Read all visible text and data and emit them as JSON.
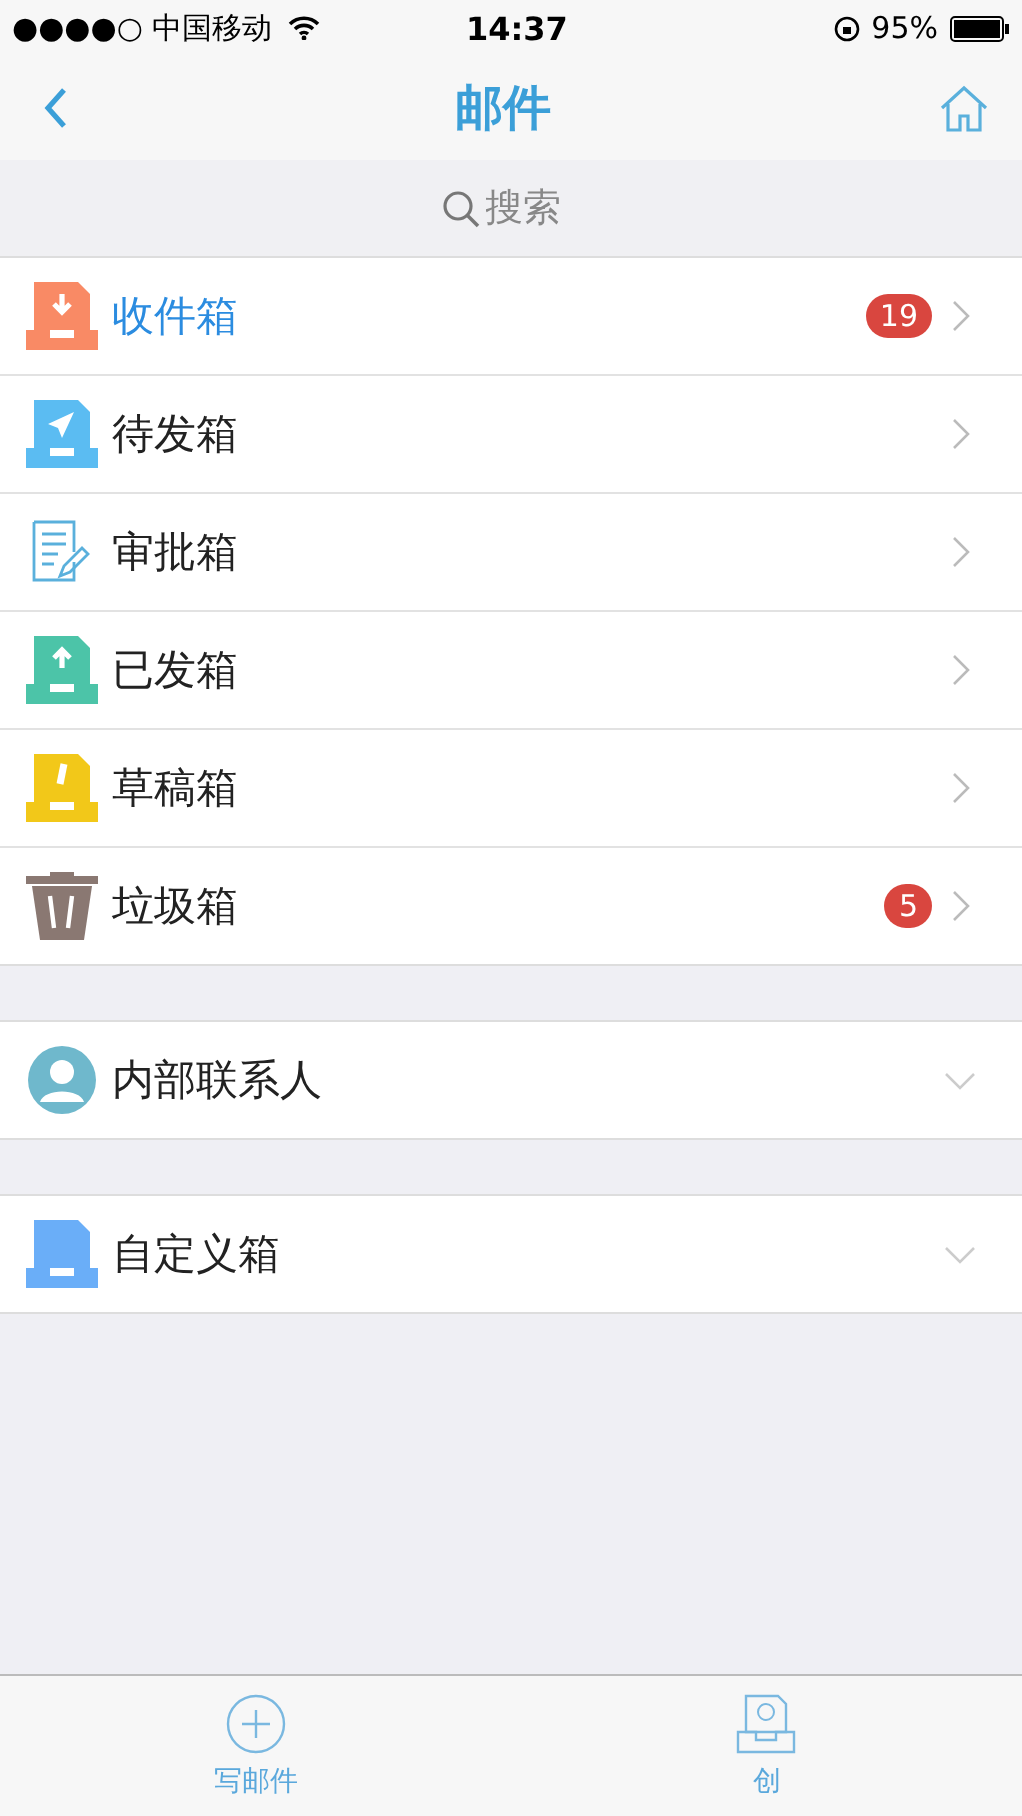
{
  "status_bar": {
    "carrier": "●●●●○ 中国移动",
    "time": "14:37",
    "battery": "95%"
  },
  "nav": {
    "title": "邮件"
  },
  "search": {
    "placeholder": "搜索"
  },
  "folders": [
    {
      "kind": "inbox",
      "label": "收件箱",
      "badge": "19",
      "selected": true
    },
    {
      "kind": "outbox",
      "label": "待发箱",
      "selected": false
    },
    {
      "kind": "approval",
      "label": "审批箱",
      "selected": false
    },
    {
      "kind": "sent",
      "label": "已发箱",
      "selected": false
    },
    {
      "kind": "drafts",
      "label": "草稿箱",
      "selected": false
    },
    {
      "kind": "trash",
      "label": "垃圾箱",
      "badge": "5",
      "selected": false
    }
  ],
  "groups": [
    {
      "kind": "contacts",
      "label": "内部联系人",
      "expanded": false
    },
    {
      "kind": "custom",
      "label": "自定义箱",
      "expanded": false
    }
  ],
  "tab_bar": [
    {
      "kind": "compose",
      "label": "写邮件"
    },
    {
      "kind": "create",
      "label": "创"
    }
  ]
}
